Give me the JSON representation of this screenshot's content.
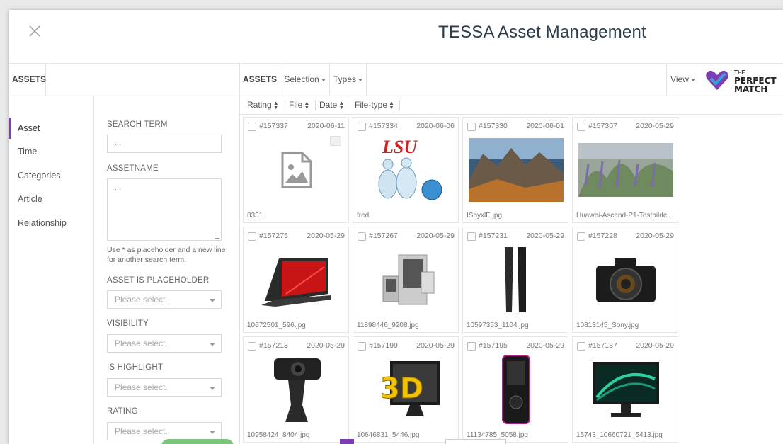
{
  "app": {
    "title": "TESSA Asset Management"
  },
  "left_tab": "ASSETS",
  "side_nav": [
    "Asset",
    "Time",
    "Categories",
    "Article",
    "Relationship"
  ],
  "search": {
    "search_term_label": "SEARCH TERM",
    "search_term_placeholder": "...",
    "assetname_label": "ASSETNAME",
    "assetname_placeholder": "...",
    "hint": "Use * as placeholder and a new line for another search term.",
    "placeholder_label": "ASSET IS PLACEHOLDER",
    "visibility_label": "VISIBILITY",
    "highlight_label": "IS HIGHLIGHT",
    "rating_label": "RATING",
    "select_placeholder": "Please select."
  },
  "toolbar": {
    "assets": "ASSETS",
    "selection": "Selection",
    "types": "Types",
    "view": "View"
  },
  "logo": {
    "line1": "THE",
    "line2": "PERFECT",
    "line3": "MATCH",
    "colors": [
      "#7b3fb3",
      "#3aa0d8"
    ]
  },
  "sort": [
    "Rating",
    "File",
    "Date",
    "File-type"
  ],
  "assets": [
    {
      "id": "#157337",
      "date": "2020-06-11",
      "name": "8331",
      "thumb": "placeholder-icon"
    },
    {
      "id": "#157334",
      "date": "2020-06-06",
      "name": "fred",
      "thumb": "bowling-pins-image",
      "text": "LSU"
    },
    {
      "id": "#157330",
      "date": "2020-06-01",
      "name": "IShyxlE.jpg",
      "thumb": "mountain-valley-image"
    },
    {
      "id": "#157307",
      "date": "2020-05-29",
      "name": "Huawei-Ascend-P1-Testbilde...",
      "thumb": "lavender-field-image"
    },
    {
      "id": "#157275",
      "date": "2020-05-29",
      "name": "10672501_596.jpg",
      "thumb": "portable-monitor-image"
    },
    {
      "id": "#157267",
      "date": "2020-05-29",
      "name": "11898446_9208.jpg",
      "thumb": "devices-image"
    },
    {
      "id": "#157231",
      "date": "2020-05-29",
      "name": "10597353_1104.jpg",
      "thumb": "speakers-image"
    },
    {
      "id": "#157228",
      "date": "2020-05-29",
      "name": "10813145_Sony.jpg",
      "thumb": "camera-image"
    },
    {
      "id": "#157213",
      "date": "2020-05-29",
      "name": "10958424_8404.jpg",
      "thumb": "webcam-image"
    },
    {
      "id": "#157199",
      "date": "2020-05-29",
      "name": "10646831_5446.jpg",
      "thumb": "3d-monitor-image",
      "text": "3D"
    },
    {
      "id": "#157195",
      "date": "2020-05-29",
      "name": "11134785_5058.jpg",
      "thumb": "mp3-player-image"
    },
    {
      "id": "#157187",
      "date": "2020-05-29",
      "name": "15743_10660721_6413.jpg",
      "thumb": "monitor-image"
    }
  ]
}
